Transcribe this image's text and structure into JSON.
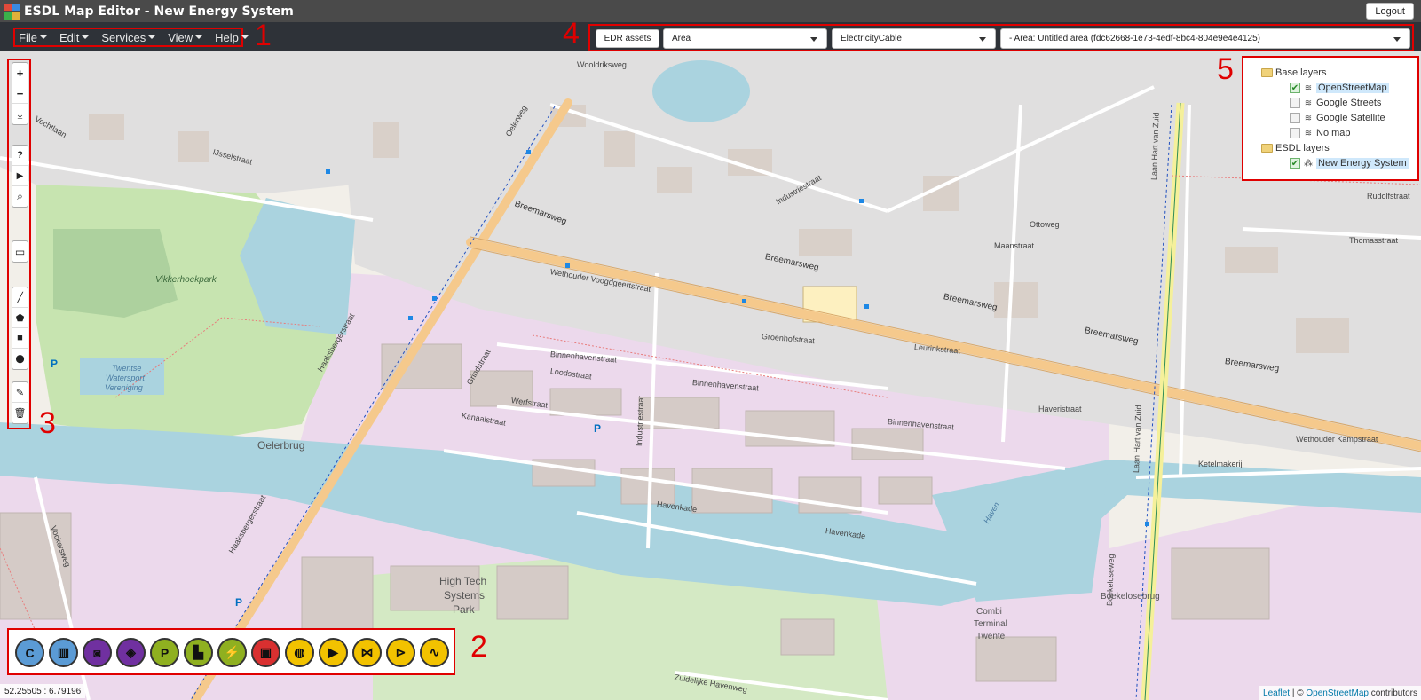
{
  "window": {
    "title": "ESDL Map Editor - New Energy System",
    "logout_label": "Logout"
  },
  "menu": {
    "items": [
      {
        "label": "File"
      },
      {
        "label": "Edit"
      },
      {
        "label": "Services"
      },
      {
        "label": "View"
      },
      {
        "label": "Help"
      }
    ]
  },
  "filters": {
    "edr_label": "EDR assets",
    "type_select": "Area",
    "asset_select": "ElectricityCable",
    "area_select": "- Area: Untitled area (fdc62668-1e73-4edf-8bc4-804e9e4e4125)"
  },
  "annotations": [
    "1",
    "2",
    "3",
    "4",
    "5"
  ],
  "toolbar": {
    "zoom_in": "+",
    "zoom_out": "−",
    "download": "⤓",
    "help": "?",
    "play": "▶",
    "search": "⌕",
    "comment": "▭",
    "polyline": "╱",
    "polygon": "⬟",
    "rectangle": "■",
    "marker": "⬤",
    "edit": "✎",
    "delete": "🗑"
  },
  "layers": {
    "base_title": "Base layers",
    "base": [
      {
        "label": "OpenStreetMap",
        "checked": true,
        "highlighted": true
      },
      {
        "label": "Google Streets",
        "checked": false
      },
      {
        "label": "Google Satellite",
        "checked": false
      },
      {
        "label": "No map",
        "checked": false
      }
    ],
    "esdl_title": "ESDL layers",
    "esdl": [
      {
        "label": "New Energy System",
        "checked": true,
        "highlighted": true
      }
    ]
  },
  "palette": [
    {
      "label": "C",
      "color": "#5b9bd5",
      "icon": "consumer-icon"
    },
    {
      "label": "▥",
      "color": "#5b9bd5",
      "icon": "radiator-icon"
    },
    {
      "label": "◙",
      "color": "#7030a0",
      "icon": "storage-icon"
    },
    {
      "label": "◈",
      "color": "#7030a0",
      "icon": "heat-exchange-icon"
    },
    {
      "label": "P",
      "color": "#8fb020",
      "icon": "producer-icon"
    },
    {
      "label": "▙",
      "color": "#8fb020",
      "icon": "plant-icon"
    },
    {
      "label": "⚡",
      "color": "#8fb020",
      "icon": "power-plant-icon"
    },
    {
      "label": "▣",
      "color": "#d93030",
      "icon": "conversion-icon"
    },
    {
      "label": "◍",
      "color": "#f2c200",
      "icon": "pump-icon"
    },
    {
      "label": "▶",
      "color": "#f2c200",
      "icon": "valve-icon"
    },
    {
      "label": "⋈",
      "color": "#f2c200",
      "icon": "joint-icon"
    },
    {
      "label": "⊳",
      "color": "#f2c200",
      "icon": "check-valve-icon"
    },
    {
      "label": "∿",
      "color": "#f2c200",
      "icon": "transformer-icon"
    }
  ],
  "map": {
    "coords": "52.25505 : 6.79196",
    "attribution_leaflet": "Leaflet",
    "attribution_sep": " | © ",
    "attribution_osm": "OpenStreetMap",
    "attribution_tail": " contributors",
    "streets": [
      "Breemarsweg",
      "Breemarsweg",
      "Breemarsweg",
      "Breemarsweg",
      "Breemarsweg",
      "Haaksbergerstraat",
      "Haaksbergerstraat",
      "Oelerweg",
      "Laan Hart van Zuid",
      "Laan Hart van Zuid",
      "Boekeloseweg",
      "Binnenhavenstraat",
      "Binnenhavenstraat",
      "Binnenhavenstraat",
      "Havenkade",
      "Havenkade",
      "Industriestraat",
      "Industriestraat",
      "Wethouder Voogdgeertstraat",
      "Groenhofstraat",
      "Wethouder Kampstraat",
      "Rudolfstraat",
      "Thomasstraat",
      "Maanstraat",
      "Ottoweg",
      "Kanaalstraat",
      "Werfstraat",
      "Loodsstraat",
      "Grindstraat",
      "Vockersweg",
      "Ketelmakerij",
      "IJsselstraat",
      "Wooldriksweg",
      "Vechtlaan",
      "Leurinkstraat",
      "Zuidelijke Havenweg",
      "Haveristraat"
    ],
    "places": [
      "Oelerbrug",
      "High Tech",
      "Systems",
      "Park",
      "Boekelosebrug",
      "Combi",
      "Terminal",
      "Twente",
      "Vikkerhoekpark",
      "Twentse",
      "Watersport",
      "Vereniging",
      "Haven",
      "P",
      "P",
      "P"
    ]
  }
}
